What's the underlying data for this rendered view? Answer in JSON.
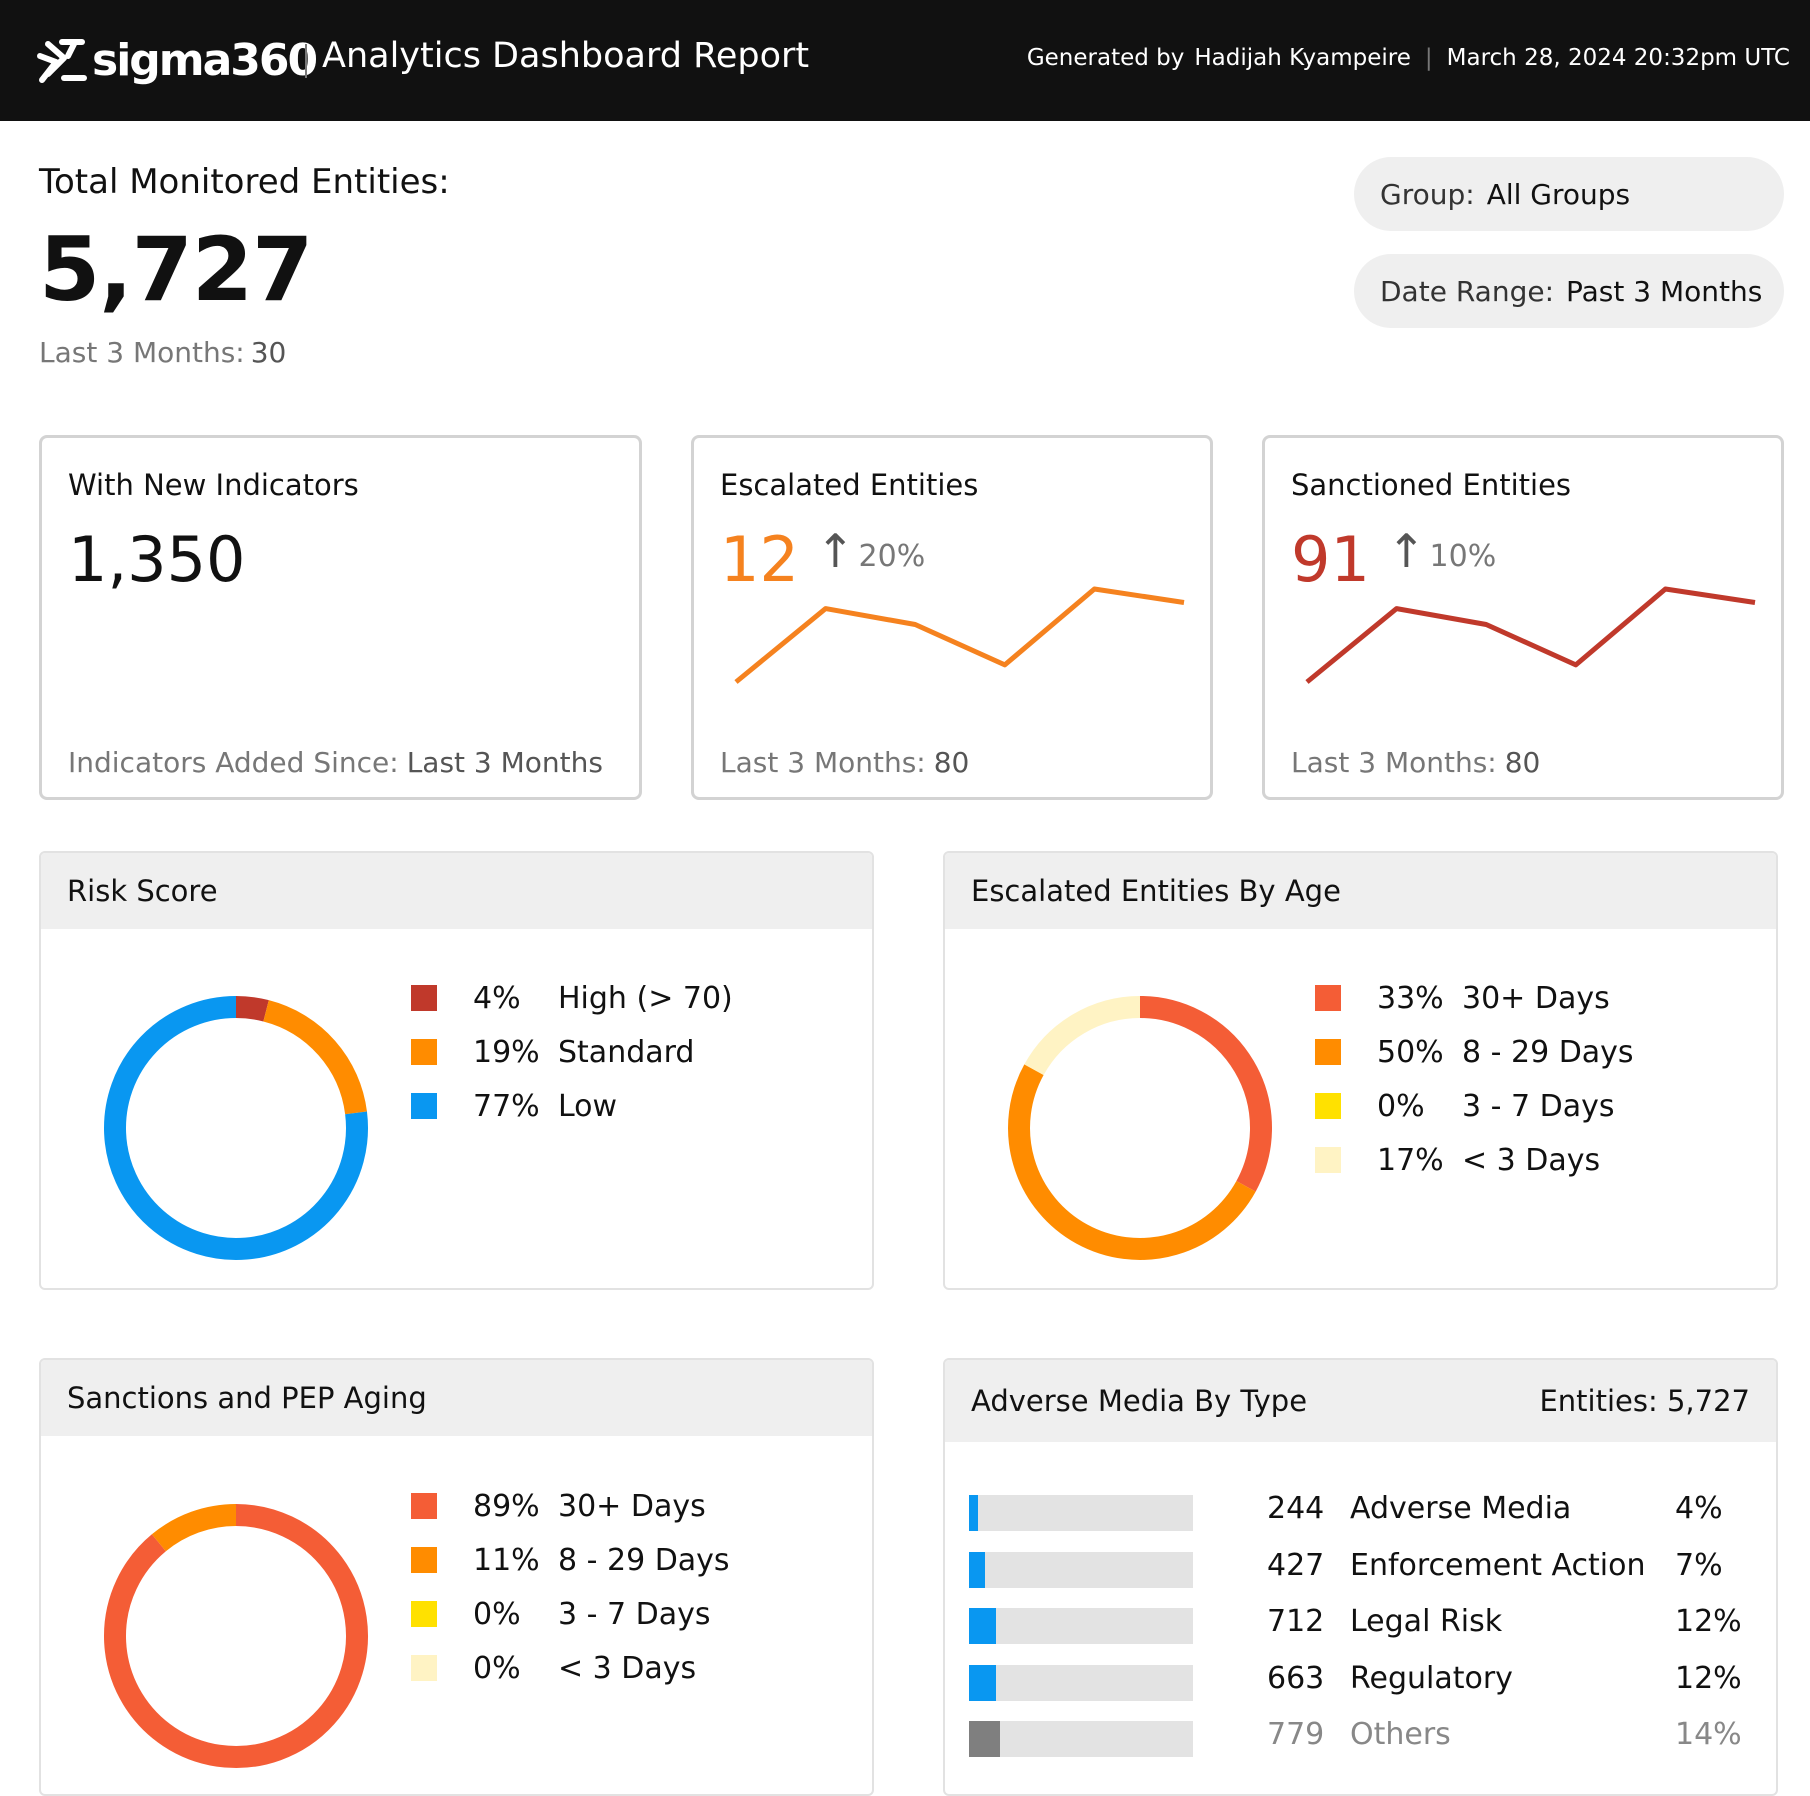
{
  "header": {
    "brand": "sigma360",
    "report_title": "Analytics Dashboard Report",
    "generated_by_label": "Generated by",
    "generated_by_name": "Hadijah Kyampeire",
    "generated_at": "March 28, 2024 20:32pm UTC"
  },
  "summary": {
    "total_label": "Total Monitored Entities:",
    "total_value": "5,727",
    "last_label": "Last 3 Months:",
    "last_value": "30"
  },
  "filters": {
    "group_label": "Group:",
    "group_value": "All Groups",
    "range_label": "Date Range:",
    "range_value": "Past 3 Months"
  },
  "kpis": [
    {
      "title": "With New Indicators",
      "value": "1,350",
      "foot_label": "Indicators Added Since:",
      "foot_value": "Last 3 Months",
      "color": "#111111"
    },
    {
      "title": "Escalated Entities",
      "value": "12",
      "trend_arrow": "↑",
      "trend": "20%",
      "foot_label": "Last 3 Months:",
      "foot_value": "80",
      "color": "#f5821f",
      "sparkline": [
        0,
        60,
        47,
        14,
        76,
        65
      ]
    },
    {
      "title": "Sanctioned Entities",
      "value": "91",
      "trend_arrow": "↑",
      "trend": "10%",
      "foot_label": "Last 3 Months:",
      "foot_value": "80",
      "color": "#c0392b",
      "sparkline": [
        0,
        60,
        47,
        14,
        76,
        65
      ]
    }
  ],
  "panels": {
    "risk_title": "Risk Score",
    "age_title": "Escalated Entities By Age",
    "sanc_title": "Sanctions and PEP Aging",
    "adv_title": "Adverse Media By Type",
    "adv_entities": "Entities: 5,727"
  },
  "chart_data": [
    {
      "type": "pie",
      "title": "Risk Score",
      "labels": [
        "High (> 70)",
        "Standard",
        "Low"
      ],
      "pct_labels": [
        "4%",
        "19%",
        "77%"
      ],
      "values": [
        4,
        19,
        77
      ],
      "colors": [
        "#c0392b",
        "#ff8c00",
        "#0997f1"
      ]
    },
    {
      "type": "pie",
      "title": "Escalated Entities By Age",
      "labels": [
        "30+ Days",
        "8 - 29 Days",
        "3 - 7 Days",
        "< 3 Days"
      ],
      "pct_labels": [
        "33%",
        "50%",
        "0%",
        "17%"
      ],
      "values": [
        33,
        50,
        0,
        17
      ],
      "colors": [
        "#f45d36",
        "#ff8c00",
        "#ffe100",
        "#fff3c4"
      ]
    },
    {
      "type": "pie",
      "title": "Sanctions and PEP Aging",
      "labels": [
        "30+ Days",
        "8 - 29 Days",
        "3 - 7 Days",
        "< 3 Days"
      ],
      "pct_labels": [
        "89%",
        "11%",
        "0%",
        "0%"
      ],
      "values": [
        89,
        11,
        0,
        0
      ],
      "colors": [
        "#f45d36",
        "#ff8c00",
        "#ffe100",
        "#fff3c4"
      ]
    },
    {
      "type": "bar",
      "title": "Adverse Media By Type",
      "categories": [
        "Adverse Media",
        "Enforcement Action",
        "Legal Risk",
        "Regulatory",
        "Others"
      ],
      "counts": [
        "244",
        "427",
        "712",
        "663",
        "779"
      ],
      "pct_labels": [
        "4%",
        "7%",
        "12%",
        "12%",
        "14%"
      ],
      "values": [
        4,
        7,
        12,
        12,
        14
      ],
      "colors": [
        "#0997f1",
        "#0997f1",
        "#0997f1",
        "#0997f1",
        "#7f7f7f"
      ],
      "xlim": [
        0,
        100
      ]
    }
  ]
}
